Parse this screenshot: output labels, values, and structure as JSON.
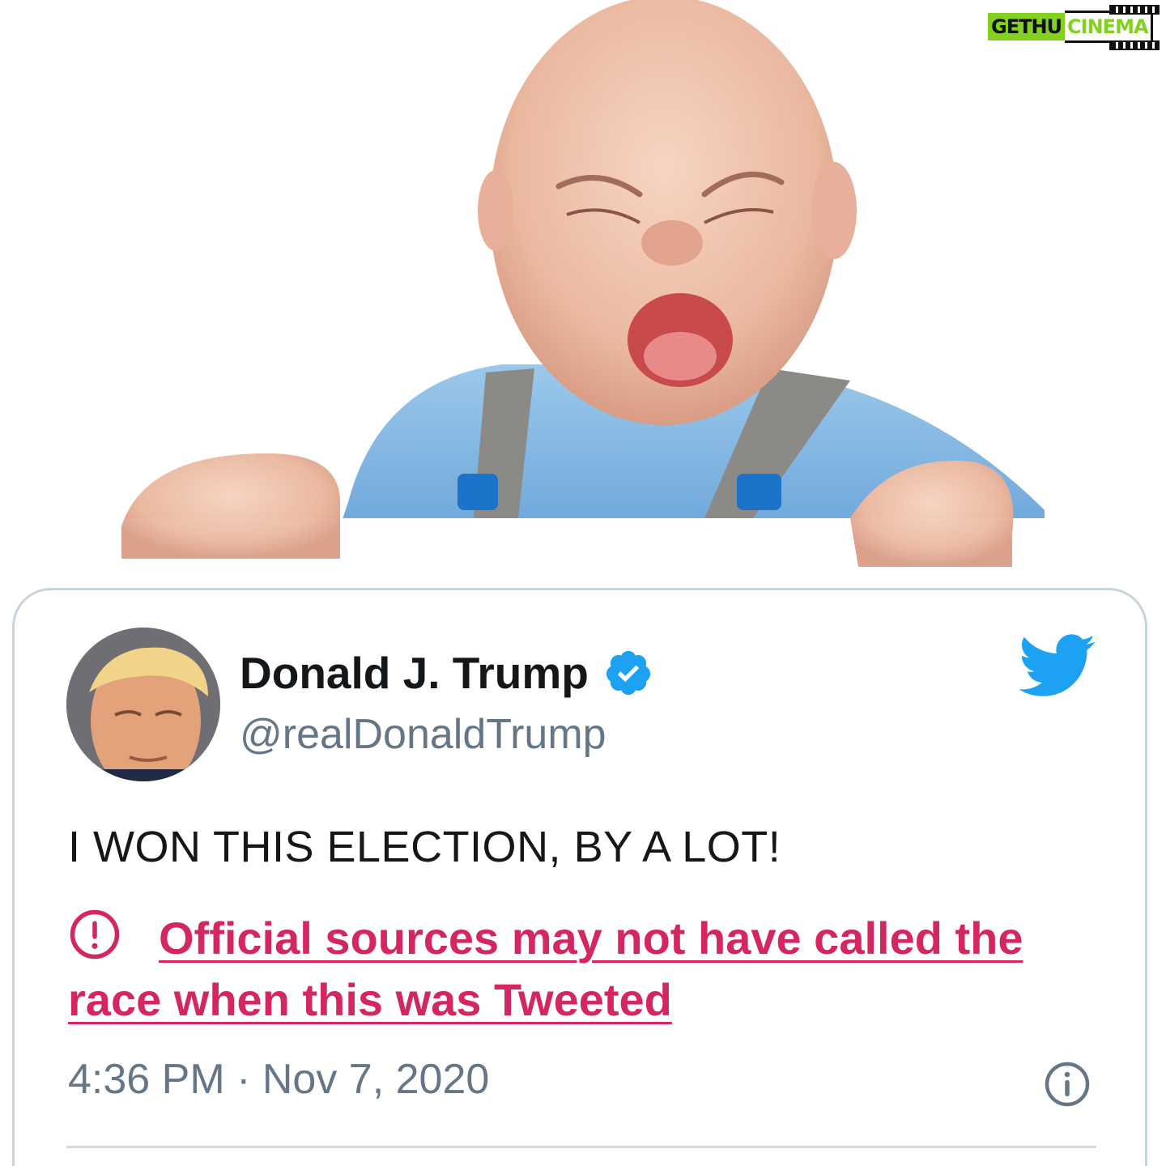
{
  "watermark": {
    "text_left": "GETHU",
    "text_right": "CINEMA"
  },
  "tweet": {
    "author_name": "Donald J. Trump",
    "handle": "@realDonaldTrump",
    "verified": true,
    "text": "I WON THIS ELECTION, BY A LOT!",
    "warning_label": "Official sources may not have called the race when this was Tweeted",
    "timestamp": "4:36 PM · Nov 7, 2020"
  },
  "icons": {
    "verified": "verified-badge-icon",
    "brand": "twitter-bird-icon",
    "warning": "exclamation-circle-icon",
    "info": "info-circle-icon"
  },
  "colors": {
    "twitter_blue": "#1da1f2",
    "warning_red": "#d4275f",
    "name_text": "#14171a",
    "muted_text": "#657786",
    "card_border": "#c9d3dc",
    "watermark_green": "#82d11e"
  }
}
